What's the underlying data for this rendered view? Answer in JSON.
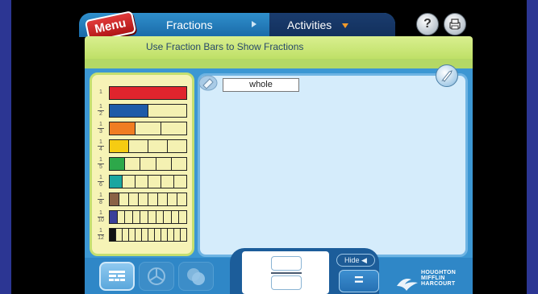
{
  "header": {
    "menu_label": "Menu",
    "tab_fractions": "Fractions",
    "tab_activities": "Activities",
    "help_label": "?"
  },
  "subtitle": "Use Fraction Bars to Show Fractions",
  "fraction_bars": [
    {
      "label_num": "1",
      "label_den": "",
      "parts": 1,
      "color": "#e0242d"
    },
    {
      "label_num": "1",
      "label_den": "2",
      "parts": 2,
      "color": "#1e5ba8"
    },
    {
      "label_num": "1",
      "label_den": "3",
      "parts": 3,
      "color": "#f07d22"
    },
    {
      "label_num": "1",
      "label_den": "4",
      "parts": 4,
      "color": "#f6cc12"
    },
    {
      "label_num": "1",
      "label_den": "5",
      "parts": 5,
      "color": "#2da84a"
    },
    {
      "label_num": "1",
      "label_den": "6",
      "parts": 6,
      "color": "#1aa6a0"
    },
    {
      "label_num": "1",
      "label_den": "8",
      "parts": 8,
      "color": "#8a6245"
    },
    {
      "label_num": "1",
      "label_den": "10",
      "parts": 10,
      "color": "#3a3f9a"
    },
    {
      "label_num": "1",
      "label_den": "12",
      "parts": 12,
      "color": "#111111"
    }
  ],
  "bar_empty_color": "#f4f1b2",
  "workspace": {
    "whole_label": "whole"
  },
  "bottom": {
    "hide_label": "Hide",
    "equals_label": "=",
    "publisher_lines": [
      "HOUGHTON",
      "MIFFLIN",
      "HARCOURT"
    ]
  }
}
